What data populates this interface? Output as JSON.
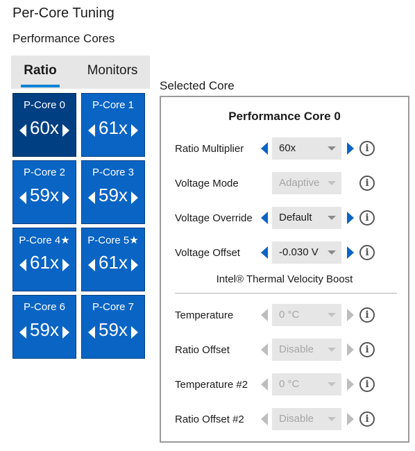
{
  "page_title": "Per-Core Tuning",
  "section_title": "Performance Cores",
  "tabs": [
    {
      "label": "Ratio",
      "active": true
    },
    {
      "label": "Monitors",
      "active": false
    }
  ],
  "cores": [
    {
      "label": "P-Core 0",
      "value": "60x",
      "selected": true
    },
    {
      "label": "P-Core 1",
      "value": "61x"
    },
    {
      "label": "P-Core 2",
      "value": "59x"
    },
    {
      "label": "P-Core 3",
      "value": "59x"
    },
    {
      "label": "P-Core 4★",
      "value": "61x"
    },
    {
      "label": "P-Core 5★",
      "value": "61x"
    },
    {
      "label": "P-Core 6",
      "value": "59x"
    },
    {
      "label": "P-Core 7",
      "value": "59x"
    }
  ],
  "selected_core": {
    "caption": "Selected Core",
    "title": "Performance Core 0",
    "settings": [
      {
        "label": "Ratio Multiplier",
        "value": "60x",
        "enabled": true,
        "arrows": true
      },
      {
        "label": "Voltage Mode",
        "value": "Adaptive",
        "enabled": false,
        "arrows": false
      },
      {
        "label": "Voltage Override",
        "value": "Default",
        "enabled": true,
        "arrows": true
      },
      {
        "label": "Voltage Offset",
        "value": "-0.030 V",
        "enabled": true,
        "arrows": true
      }
    ],
    "tvb_title": "Intel® Thermal Velocity Boost",
    "tvb_settings": [
      {
        "label": "Temperature",
        "value": "0 °C",
        "enabled": false
      },
      {
        "label": "Ratio Offset",
        "value": "Disable",
        "enabled": false
      },
      {
        "label": "Temperature #2",
        "value": "0 °C",
        "enabled": false
      },
      {
        "label": "Ratio Offset #2",
        "value": "Disable",
        "enabled": false
      }
    ]
  },
  "colors": {
    "tile": "#0a64c4",
    "tile_selected": "#003f82",
    "accent": "#0a84d6"
  }
}
